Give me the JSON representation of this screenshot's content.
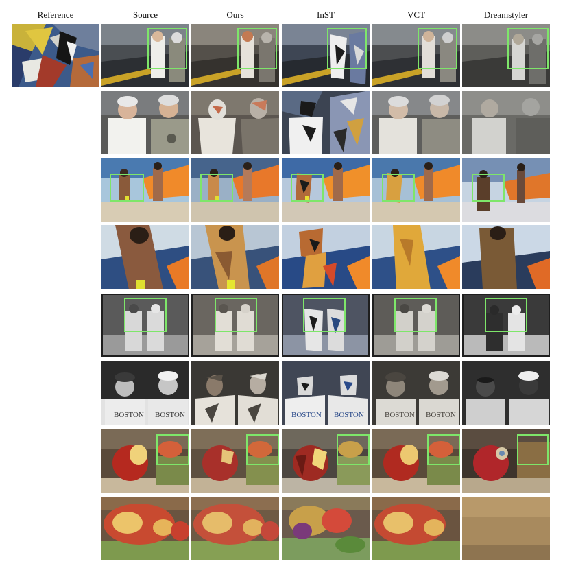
{
  "figure": {
    "columns": [
      {
        "key": "reference",
        "label": "Reference"
      },
      {
        "key": "source",
        "label": "Source"
      },
      {
        "key": "ours",
        "label": "Ours"
      },
      {
        "key": "inst",
        "label": "InST"
      },
      {
        "key": "vct",
        "label": "VCT"
      },
      {
        "key": "dreamstyler",
        "label": "Dreamstyler"
      }
    ],
    "rows": [
      {
        "scene": "workers",
        "view": "full",
        "boxed": true
      },
      {
        "scene": "workers",
        "view": "crop",
        "boxed": false
      },
      {
        "scene": "surfers",
        "view": "full",
        "boxed": true
      },
      {
        "scene": "surfers",
        "view": "crop",
        "boxed": false
      },
      {
        "scene": "baseball",
        "view": "full",
        "boxed": true
      },
      {
        "scene": "baseball",
        "view": "crop",
        "boxed": false
      },
      {
        "scene": "apple",
        "view": "full",
        "boxed": true
      },
      {
        "scene": "apple",
        "view": "crop",
        "boxed": false
      }
    ],
    "highlight_color": "#7ee66a"
  }
}
